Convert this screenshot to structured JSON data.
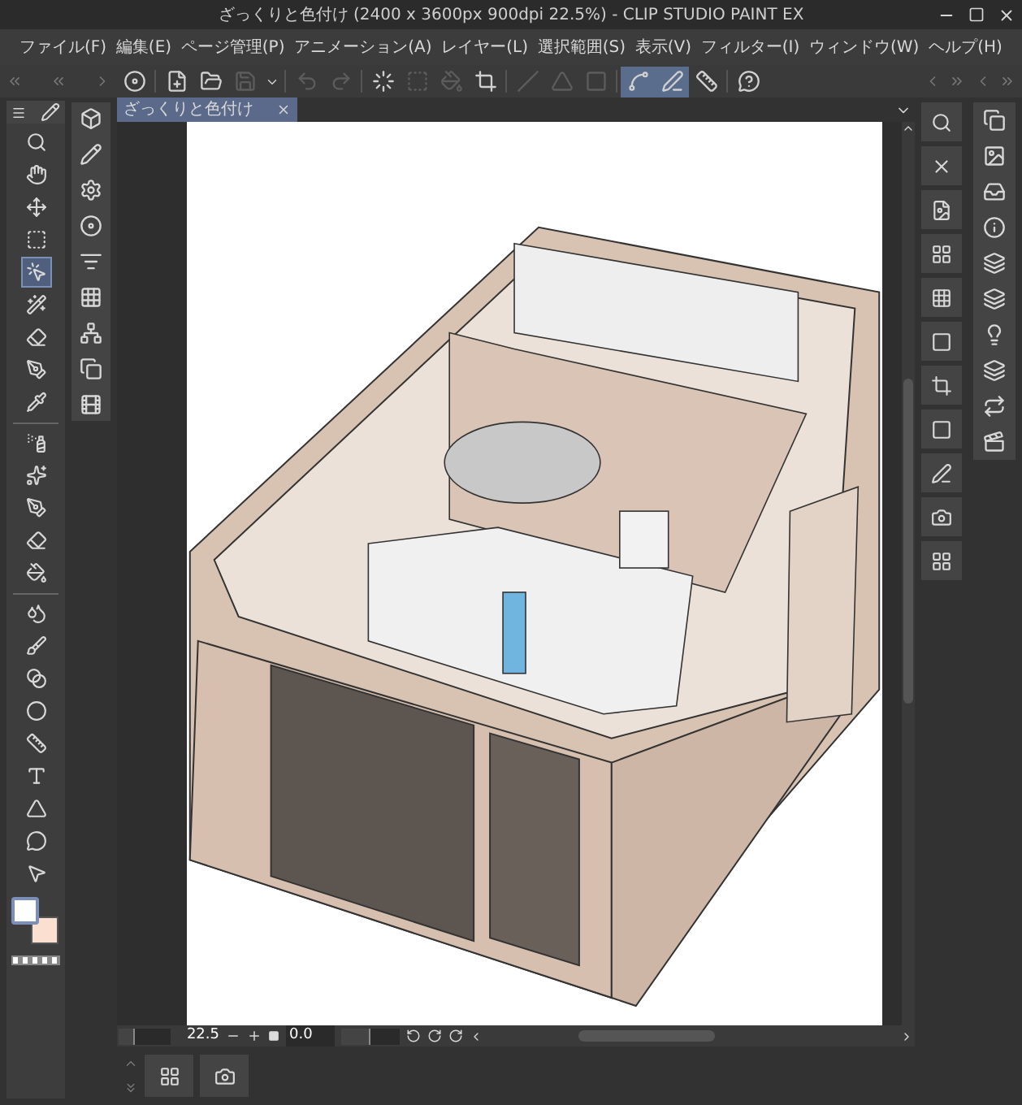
{
  "window": {
    "title": "ざっくりと色付け (2400 x 3600px 900dpi 22.5%)  - CLIP STUDIO PAINT EX"
  },
  "menu": [
    "ファイル(F)",
    "編集(E)",
    "ページ管理(P)",
    "アニメーション(A)",
    "レイヤー(L)",
    "選択範囲(S)",
    "表示(V)",
    "フィルター(I)",
    "ウィンドウ(W)",
    "ヘルプ(H)"
  ],
  "command_bar": [
    {
      "on": false,
      "disabled": false
    },
    {
      "on": false,
      "disabled": false
    },
    {
      "on": false,
      "disabled": false
    },
    {
      "on": false,
      "disabled": true
    },
    {
      "on": false,
      "disabled": false
    },
    {
      "on": false,
      "disabled": true
    },
    {
      "on": false,
      "disabled": true
    },
    {
      "on": false,
      "disabled": false
    },
    {
      "on": false,
      "disabled": true
    },
    {
      "on": false,
      "disabled": true
    },
    {
      "on": false,
      "disabled": false
    },
    {
      "on": false,
      "disabled": true
    },
    {
      "on": false,
      "disabled": true
    },
    {
      "on": false,
      "disabled": true
    },
    {
      "on": true,
      "disabled": false
    },
    {
      "on": true,
      "disabled": false
    },
    {
      "on": false,
      "disabled": false
    },
    {
      "on": false,
      "disabled": false
    }
  ],
  "tools": [
    {
      "selected": false
    },
    {
      "selected": false
    },
    {
      "selected": false
    },
    {
      "selected": false
    },
    {
      "selected": true
    },
    {
      "selected": false
    },
    {
      "selected": false
    },
    {
      "selected": false
    },
    {
      "selected": false
    },
    {
      "selected": false
    },
    {
      "selected": false
    },
    {
      "selected": false
    },
    {
      "selected": false
    },
    {
      "selected": false
    },
    {
      "selected": false
    },
    {
      "selected": false
    },
    {
      "selected": false
    },
    {
      "selected": false
    },
    {
      "selected": false
    },
    {
      "selected": false
    },
    {
      "selected": false
    },
    {
      "selected": false
    },
    {
      "selected": false
    }
  ],
  "colors": [
    {
      "color": "#ffffff",
      "selected": true
    },
    {
      "color": "#fbe0d2",
      "selected": false
    }
  ],
  "document_tab": {
    "title": "ざっくりと色付け",
    "selected": true
  },
  "status_bar": {
    "zoom": "22.5",
    "angle": "0.0",
    "zoom_slider": {
      "level": 0.3
    },
    "angle_slider": {
      "level": 0.5
    }
  }
}
